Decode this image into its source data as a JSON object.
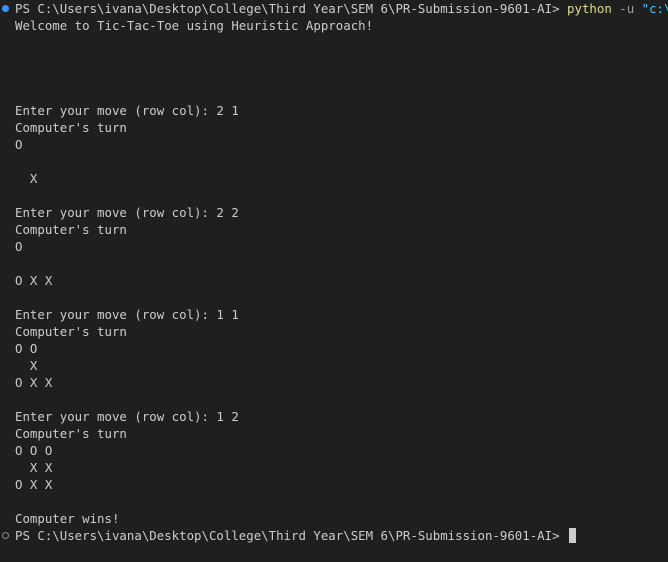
{
  "terminal": {
    "prompt_path": "PS C:\\Users\\ivana\\Desktop\\College\\Third Year\\SEM 6\\PR-Submission-9601-AI> ",
    "command": {
      "program": "python",
      "flag": " -u ",
      "arg": "\"c:\\Users"
    },
    "output_lines": [
      "Welcome to Tic-Tac-Toe using Heuristic Approach!",
      "",
      "",
      "",
      "",
      "Enter your move (row col): 2 1",
      "Computer's turn",
      "O",
      "",
      "  X",
      "",
      "Enter your move (row col): 2 2",
      "Computer's turn",
      "O",
      "",
      "O X X",
      "",
      "Enter your move (row col): 1 1",
      "Computer's turn",
      "O O",
      "  X",
      "O X X",
      "",
      "Enter your move (row col): 1 2",
      "Computer's turn",
      "O O O",
      "  X X",
      "O X X",
      "",
      "Computer wins!"
    ],
    "final_prompt": "PS C:\\Users\\ivana\\Desktop\\College\\Third Year\\SEM 6\\PR-Submission-9601-AI> ",
    "colors": {
      "background": "#1f1f1f",
      "text": "#cccccc",
      "python_command": "#dcdc8b",
      "string_arg": "#4fc1ff",
      "status_dot_success": "#3794ff"
    },
    "icons": {
      "first_marker": "command-success-dot-icon",
      "last_marker": "command-pending-dot-icon",
      "cursor": "block-cursor-icon"
    }
  }
}
